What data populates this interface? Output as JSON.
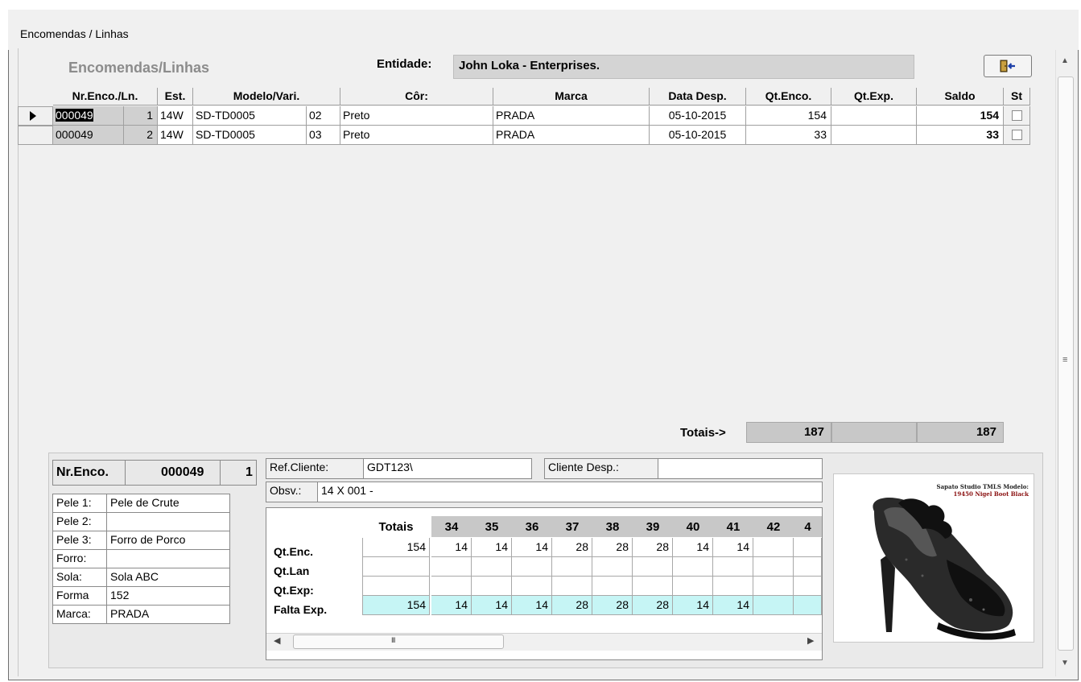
{
  "window": {
    "title": "Encomendas / Linhas"
  },
  "header": {
    "form_title": "Encomendas/Linhas",
    "entity_label": "Entidade:",
    "entity_value": "John Loka - Enterprises."
  },
  "grid": {
    "columns": [
      "Nr.Enco./Ln.",
      "Est.",
      "Modelo/Vari.",
      "Côr:",
      "Marca",
      "Data Desp.",
      "Qt.Enco.",
      "Qt.Exp.",
      "Saldo",
      "St"
    ],
    "rows": [
      {
        "nr": "000049",
        "ln": "1",
        "est": "14W",
        "modelo": "SD-TD0005",
        "vari": "02",
        "cor": "Preto",
        "marca": "PRADA",
        "data": "05-10-2015",
        "qt_enco": "154",
        "qt_exp": "",
        "saldo": "154",
        "selected": true
      },
      {
        "nr": "000049",
        "ln": "2",
        "est": "14W",
        "modelo": "SD-TD0005",
        "vari": "03",
        "cor": "Preto",
        "marca": "PRADA",
        "data": "05-10-2015",
        "qt_enco": "33",
        "qt_exp": "",
        "saldo": "33",
        "selected": false
      }
    ]
  },
  "totals": {
    "label": "Totais->",
    "qt_enco": "187",
    "qt_exp": "",
    "saldo": "187"
  },
  "detail": {
    "nr_label": "Nr.Enco.",
    "nr_value": "000049",
    "ln_value": "1",
    "materials": [
      {
        "label": "Pele 1:",
        "value": "Pele de Crute"
      },
      {
        "label": "Pele 2:",
        "value": ""
      },
      {
        "label": "Pele 3:",
        "value": "Forro de Porco"
      },
      {
        "label": "Forro:",
        "value": ""
      },
      {
        "label": "Sola:",
        "value": "Sola ABC"
      },
      {
        "label": "Forma",
        "value": "152"
      },
      {
        "label": "Marca:",
        "value": "PRADA"
      }
    ],
    "ref_cliente_label": "Ref.Cliente:",
    "ref_cliente_value": "GDT123\\",
    "cliente_desp_label": "Cliente Desp.:",
    "cliente_desp_value": "",
    "obsv_label": "Obsv.:",
    "obsv_value": "14 X 001 -"
  },
  "sizes": {
    "totais_header": "Totais",
    "sizes": [
      "34",
      "35",
      "36",
      "37",
      "38",
      "39",
      "40",
      "41",
      "42",
      "4"
    ],
    "rows": [
      {
        "label": "Qt.Enc.",
        "total": "154",
        "values": [
          "14",
          "14",
          "14",
          "28",
          "28",
          "28",
          "14",
          "14",
          "",
          ""
        ]
      },
      {
        "label": "Qt.Lan",
        "total": "",
        "values": [
          "",
          "",
          "",
          "",
          "",
          "",
          "",
          "",
          "",
          ""
        ]
      },
      {
        "label": "Qt.Exp:",
        "total": "",
        "values": [
          "",
          "",
          "",
          "",
          "",
          "",
          "",
          "",
          "",
          ""
        ]
      },
      {
        "label": "Falta Exp.",
        "total": "154",
        "values": [
          "14",
          "14",
          "14",
          "28",
          "28",
          "28",
          "14",
          "14",
          "",
          ""
        ]
      }
    ],
    "scroll_grip": "III"
  },
  "product_image": {
    "caption_line1": "Sapato Studio TMLS Modelo:",
    "caption_line2": "19450 Nigel Boot Black"
  },
  "icons": {
    "exit": "exit-door-icon",
    "row_pointer": "row-pointer-icon"
  }
}
